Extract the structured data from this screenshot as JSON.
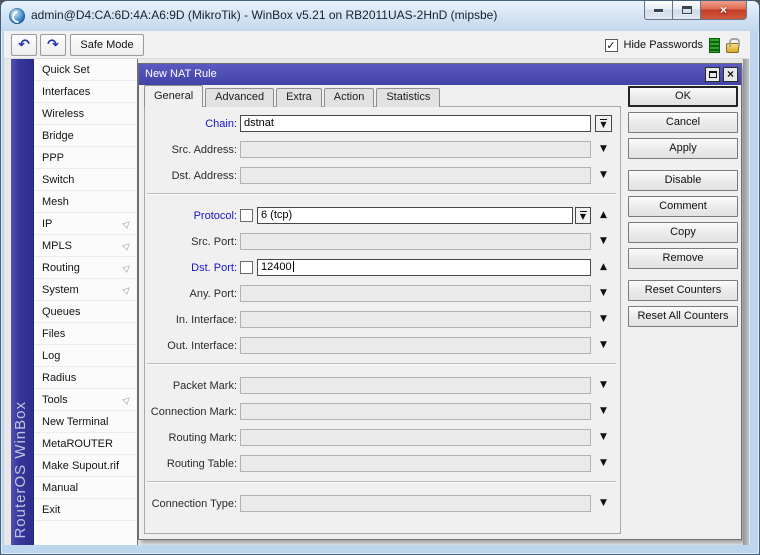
{
  "window": {
    "title": "admin@D4:CA:6D:4A:A6:9D (MikroTik) - WinBox v5.21 on RB2011UAS-2HnD (mipsbe)"
  },
  "icons": {
    "app": "winbox-swirl",
    "undo": "↶",
    "redo": "↷",
    "minimize": "bar",
    "maximize": "box",
    "close": "×",
    "dialog_maximize": "box",
    "dialog_close": "×",
    "checkmark": "✓",
    "dropdown": "▼",
    "collapse": "▲",
    "submenu": "▷",
    "lock": "gold-padlock",
    "traffic_indicator": "green-bars"
  },
  "toolbar": {
    "safe_mode_label": "Safe Mode",
    "hide_passwords_label": "Hide Passwords",
    "hide_passwords_checked": true
  },
  "sidebar": {
    "brand": "RouterOS WinBox",
    "items": [
      {
        "label": "Quick Set",
        "submenu": false
      },
      {
        "label": "Interfaces",
        "submenu": false
      },
      {
        "label": "Wireless",
        "submenu": false
      },
      {
        "label": "Bridge",
        "submenu": false
      },
      {
        "label": "PPP",
        "submenu": false
      },
      {
        "label": "Switch",
        "submenu": false
      },
      {
        "label": "Mesh",
        "submenu": false
      },
      {
        "label": "IP",
        "submenu": true
      },
      {
        "label": "MPLS",
        "submenu": true
      },
      {
        "label": "Routing",
        "submenu": true
      },
      {
        "label": "System",
        "submenu": true
      },
      {
        "label": "Queues",
        "submenu": false
      },
      {
        "label": "Files",
        "submenu": false
      },
      {
        "label": "Log",
        "submenu": false
      },
      {
        "label": "Radius",
        "submenu": false
      },
      {
        "label": "Tools",
        "submenu": true
      },
      {
        "label": "New Terminal",
        "submenu": false
      },
      {
        "label": "MetaROUTER",
        "submenu": false
      },
      {
        "label": "Make Supout.rif",
        "submenu": false
      },
      {
        "label": "Manual",
        "submenu": false
      },
      {
        "label": "Exit",
        "submenu": false
      }
    ]
  },
  "dialog": {
    "title": "New NAT Rule",
    "tabs": [
      {
        "label": "General",
        "active": true
      },
      {
        "label": "Advanced",
        "active": false
      },
      {
        "label": "Extra",
        "active": false
      },
      {
        "label": "Action",
        "active": false
      },
      {
        "label": "Statistics",
        "active": false
      }
    ],
    "form": {
      "rows": [
        {
          "label": "Chain:",
          "accent": true,
          "value": "dstnat",
          "filled": true,
          "trail": "dropbtn"
        },
        {
          "label": "Src. Address:",
          "accent": false,
          "value": "",
          "filled": false,
          "trail": "down"
        },
        {
          "label": "Dst. Address:",
          "accent": false,
          "value": "",
          "filled": false,
          "trail": "down"
        },
        {
          "label": "Protocol:",
          "accent": true,
          "checkbox": false,
          "value": "6 (tcp)",
          "filled": true,
          "attached_dropdown": true,
          "trail": "up",
          "separator_before": true
        },
        {
          "label": "Src. Port:",
          "accent": false,
          "value": "",
          "filled": false,
          "trail": "down"
        },
        {
          "label": "Dst. Port:",
          "accent": true,
          "checkbox": false,
          "value": "12400",
          "filled": true,
          "caret": true,
          "trail": "up"
        },
        {
          "label": "Any. Port:",
          "accent": false,
          "value": "",
          "filled": false,
          "trail": "down"
        },
        {
          "label": "In. Interface:",
          "accent": false,
          "value": "",
          "filled": false,
          "trail": "down"
        },
        {
          "label": "Out. Interface:",
          "accent": false,
          "value": "",
          "filled": false,
          "trail": "down"
        },
        {
          "label": "Packet Mark:",
          "accent": false,
          "value": "",
          "filled": false,
          "trail": "down",
          "separator_before": true
        },
        {
          "label": "Connection Mark:",
          "accent": false,
          "value": "",
          "filled": false,
          "trail": "down"
        },
        {
          "label": "Routing Mark:",
          "accent": false,
          "value": "",
          "filled": false,
          "trail": "down"
        },
        {
          "label": "Routing Table:",
          "accent": false,
          "value": "",
          "filled": false,
          "trail": "down"
        },
        {
          "label": "Connection Type:",
          "accent": false,
          "value": "",
          "filled": false,
          "trail": "down",
          "separator_before": true
        }
      ]
    },
    "buttons": [
      {
        "label": "OK",
        "default": true
      },
      {
        "label": "Cancel"
      },
      {
        "label": "Apply"
      },
      {
        "label": "Disable",
        "gap_before": true
      },
      {
        "label": "Comment"
      },
      {
        "label": "Copy"
      },
      {
        "label": "Remove"
      },
      {
        "label": "Reset Counters",
        "gap_before": true
      },
      {
        "label": "Reset All Counters"
      }
    ]
  },
  "colors": {
    "dialog_titlebar_blue": "#4b4bb0",
    "sidebar_strip_blue": "#37379b",
    "accent_label_blue": "#1515cd",
    "close_button_red": "#c33d26",
    "aero_frame_blue": "#bdd6ee"
  }
}
